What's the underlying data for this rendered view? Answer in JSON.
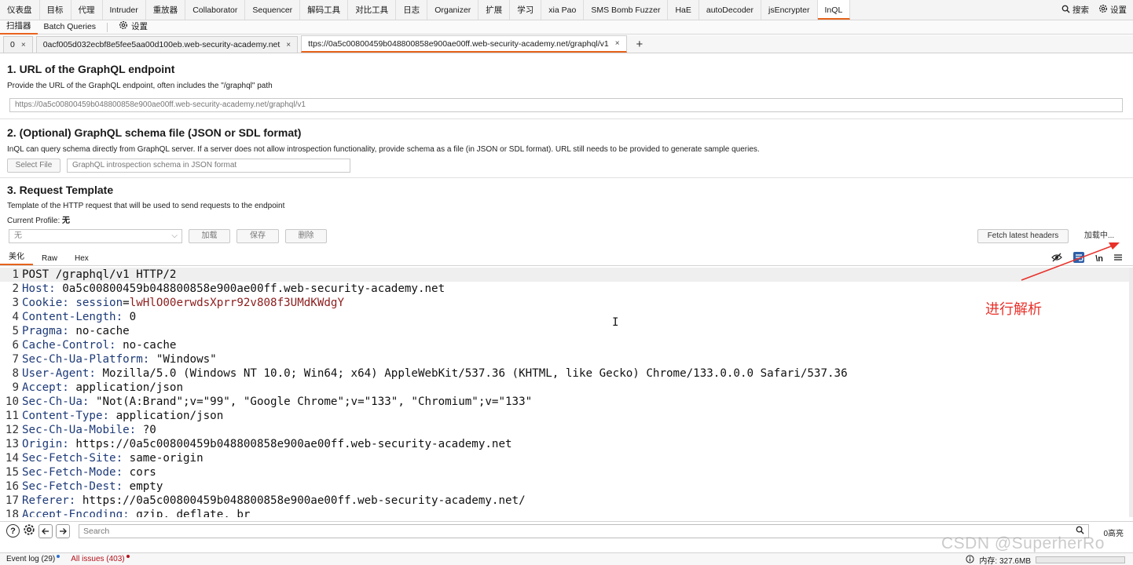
{
  "menu": {
    "items": [
      "仪表盘",
      "目标",
      "代理",
      "Intruder",
      "重放器",
      "Collaborator",
      "Sequencer",
      "解码工具",
      "对比工具",
      "日志",
      "Organizer",
      "扩展",
      "学习",
      "xia Pao",
      "SMS Bomb Fuzzer",
      "HaE",
      "autoDecoder",
      "jsEncrypter",
      "InQL"
    ],
    "active": "InQL",
    "search_label": "搜索",
    "settings_label": "设置"
  },
  "subtabs": {
    "scanner": "扫描器",
    "batch": "Batch Queries",
    "settings": "设置"
  },
  "urltabs": [
    {
      "label": "0",
      "close": "×"
    },
    {
      "label": "0acf005d032ecbf8e5fee5aa00d100eb.web-security-academy.net",
      "close": "×"
    },
    {
      "label": "ttps://0a5c00800459b048800858e900ae00ff.web-security-academy.net/graphql/v1",
      "close": "×"
    }
  ],
  "add_tab": "+",
  "section1": {
    "title": "1. URL of the GraphQL endpoint",
    "desc": "Provide the URL of the GraphQL endpoint, often includes the \"/graphql\" path",
    "url_value": "https://0a5c00800459b048800858e900ae00ff.web-security-academy.net/graphql/v1"
  },
  "section2": {
    "title": "2. (Optional) GraphQL schema file (JSON or SDL format)",
    "desc": "InQL can query schema directly from GraphQL server. If a server does not allow introspection functionality, provide schema as a file (in JSON or SDL format). URL still needs to be provided to generate sample queries.",
    "select_file": "Select File",
    "schema_placeholder": "GraphQL introspection schema in JSON format"
  },
  "section3": {
    "title": "3. Request Template",
    "desc": "Template of the HTTP request that will be used to send requests to the endpoint",
    "profile_label": "Current Profile:",
    "profile_value": "无",
    "select_value": "无",
    "load": "加载",
    "save": "保存",
    "delete": "删除",
    "fetch_headers": "Fetch latest headers",
    "loading": "加载中..."
  },
  "editor_tabs": [
    "美化",
    "Raw",
    "Hex"
  ],
  "editor_tools": {
    "newline": "\\n"
  },
  "request_lines": [
    {
      "n": "1",
      "text": "POST /graphql/v1 HTTP/2"
    },
    {
      "n": "2",
      "key": "Host",
      "val": " 0a5c00800459b048800858e900ae00ff.web-security-academy.net"
    },
    {
      "n": "3",
      "key": "Cookie",
      "ckey": "session",
      "cval": "lwHlO00erwdsXprr92v808f3UMdKWdgY"
    },
    {
      "n": "4",
      "key": "Content-Length",
      "val": " 0"
    },
    {
      "n": "5",
      "key": "Pragma",
      "val": " no-cache"
    },
    {
      "n": "6",
      "key": "Cache-Control",
      "val": " no-cache"
    },
    {
      "n": "7",
      "key": "Sec-Ch-Ua-Platform",
      "val": " \"Windows\""
    },
    {
      "n": "8",
      "key": "User-Agent",
      "val": " Mozilla/5.0 (Windows NT 10.0; Win64; x64) AppleWebKit/537.36 (KHTML, like Gecko) Chrome/133.0.0.0 Safari/537.36"
    },
    {
      "n": "9",
      "key": "Accept",
      "val": " application/json"
    },
    {
      "n": "10",
      "key": "Sec-Ch-Ua",
      "val": " \"Not(A:Brand\";v=\"99\", \"Google Chrome\";v=\"133\", \"Chromium\";v=\"133\""
    },
    {
      "n": "11",
      "key": "Content-Type",
      "val": " application/json"
    },
    {
      "n": "12",
      "key": "Sec-Ch-Ua-Mobile",
      "val": " ?0"
    },
    {
      "n": "13",
      "key": "Origin",
      "val": " https://0a5c00800459b048800858e900ae00ff.web-security-academy.net"
    },
    {
      "n": "14",
      "key": "Sec-Fetch-Site",
      "val": " same-origin"
    },
    {
      "n": "15",
      "key": "Sec-Fetch-Mode",
      "val": " cors"
    },
    {
      "n": "16",
      "key": "Sec-Fetch-Dest",
      "val": " empty"
    },
    {
      "n": "17",
      "key": "Referer",
      "val": " https://0a5c00800459b048800858e900ae00ff.web-security-academy.net/"
    },
    {
      "n": "18",
      "key": "Accept-Encoding",
      "val": " gzip, deflate, br"
    }
  ],
  "search": {
    "placeholder": "Search",
    "hits": "0高亮"
  },
  "status": {
    "event_log": "Event log (29)",
    "issues": "All issues (403)",
    "memory": "内存: 327.6MB"
  },
  "annotation": "进行解析",
  "watermark": "CSDN @SuperherRo",
  "colors": {
    "accent": "#e6631c",
    "annotation": "#e8312a",
    "header_key": "#1d3a78",
    "cookie_value": "#8c1d1d"
  }
}
